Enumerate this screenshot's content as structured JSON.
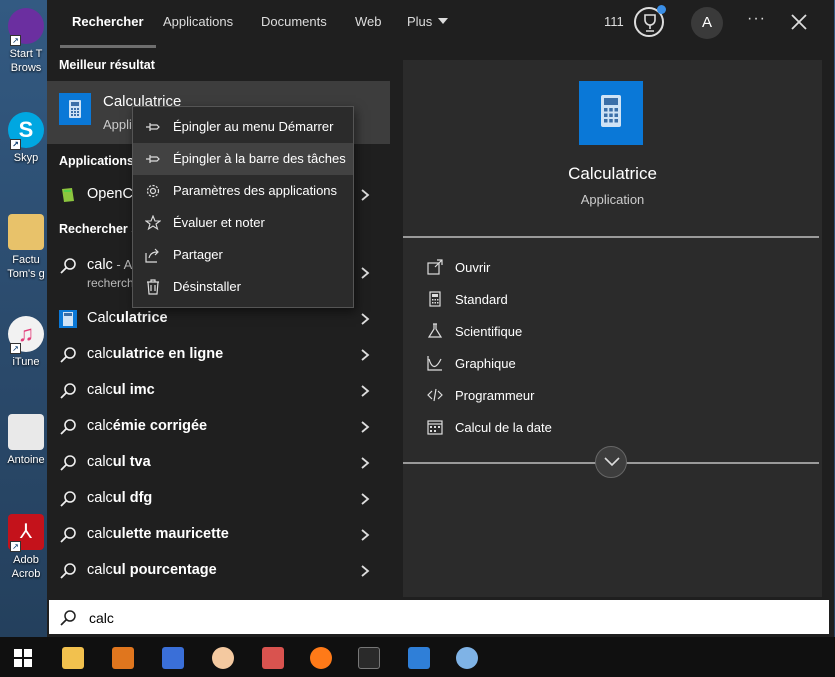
{
  "desktop": {
    "icons": [
      {
        "label": "Start T Brows",
        "line1": "Start T",
        "line2": "Brows",
        "color": "#6b2fa0"
      },
      {
        "label": "Skyp",
        "line1": "Skyp",
        "line2": "",
        "color": "#00a7e1"
      },
      {
        "label": "Factu Tom's g",
        "line1": "Factu",
        "line2": "Tom's g",
        "color": "#e8c26a"
      },
      {
        "label": "iTune",
        "line1": "iTune",
        "line2": "",
        "color": "#f2f2f2"
      },
      {
        "label": "Antoine",
        "line1": "Antoine",
        "line2": "",
        "color": "#e9e9e9"
      },
      {
        "label": "Adob Acrob",
        "line1": "Adob",
        "line2": "Acrob",
        "color": "#c4121b"
      }
    ]
  },
  "header": {
    "tabs": [
      "Rechercher",
      "Applications",
      "Documents",
      "Web",
      "Plus"
    ],
    "active_tab": "Rechercher",
    "points": "111",
    "trophy_icon": "trophy-icon",
    "avatar_initial": "A",
    "more_label": "···",
    "close_icon": "close-icon"
  },
  "left": {
    "best_section": "Meilleur résultat",
    "best": {
      "name": "Calculatrice",
      "sub": "Application"
    },
    "apps_section": "Applications",
    "apps_item": "OpenCalc",
    "search_section": "Rechercher sur le web",
    "calc_row": {
      "title": "calc",
      "suffix": " - A",
      "sub": "recherche"
    },
    "suggestions": [
      {
        "prefix": "Calc",
        "rest": "ulatrice",
        "icon": "calculator-icon"
      },
      {
        "prefix": "calc",
        "rest": "ulatrice en ligne",
        "icon": "search-icon"
      },
      {
        "prefix": "calc",
        "rest": "ul imc",
        "icon": "search-icon"
      },
      {
        "prefix": "calc",
        "rest": "émie corrigée",
        "icon": "search-icon"
      },
      {
        "prefix": "calc",
        "rest": "ul tva",
        "icon": "search-icon"
      },
      {
        "prefix": "calc",
        "rest": "ul dfg",
        "icon": "search-icon"
      },
      {
        "prefix": "calc",
        "rest": "ulette mauricette",
        "icon": "search-icon"
      },
      {
        "prefix": "calc",
        "rest": "ul pourcentage",
        "icon": "search-icon"
      }
    ]
  },
  "context_menu": {
    "items": [
      {
        "label": "Épingler au menu Démarrer",
        "icon": "pin-icon"
      },
      {
        "label": "Épingler à la barre des tâches",
        "icon": "pin-icon"
      },
      {
        "label": "Paramètres des applications",
        "icon": "gear-icon"
      },
      {
        "label": "Évaluer et noter",
        "icon": "star-icon"
      },
      {
        "label": "Partager",
        "icon": "share-icon"
      },
      {
        "label": "Désinstaller",
        "icon": "trash-icon"
      }
    ],
    "hovered_index": 1
  },
  "details": {
    "title": "Calculatrice",
    "subtitle": "Application",
    "actions": [
      {
        "label": "Ouvrir",
        "icon": "open-icon"
      },
      {
        "label": "Standard",
        "icon": "calculator-icon"
      },
      {
        "label": "Scientifique",
        "icon": "flask-icon"
      },
      {
        "label": "Graphique",
        "icon": "graph-icon"
      },
      {
        "label": "Programmeur",
        "icon": "code-icon"
      },
      {
        "label": "Calcul de la date",
        "icon": "calendar-icon"
      }
    ]
  },
  "search": {
    "value": "calc",
    "icon": "search-icon"
  },
  "taskbar": {
    "items": [
      {
        "name": "start-button",
        "color": "#ffffff"
      },
      {
        "name": "file-explorer-icon",
        "color": "#f2c14e"
      },
      {
        "name": "app-orange-icon",
        "color": "#e0761e"
      },
      {
        "name": "bird-app-icon",
        "color": "#3a6fd8"
      },
      {
        "name": "face-app-icon",
        "color": "#f4c9a0"
      },
      {
        "name": "checklist-app-icon",
        "color": "#d9534f"
      },
      {
        "name": "firefox-icon",
        "color": "#ff7a18"
      },
      {
        "name": "live-app-icon",
        "color": "#2a2a2a"
      },
      {
        "name": "calculator-app-icon",
        "color": "#2f7fd8"
      },
      {
        "name": "paint-app-icon",
        "color": "#7fb3e6"
      }
    ]
  }
}
